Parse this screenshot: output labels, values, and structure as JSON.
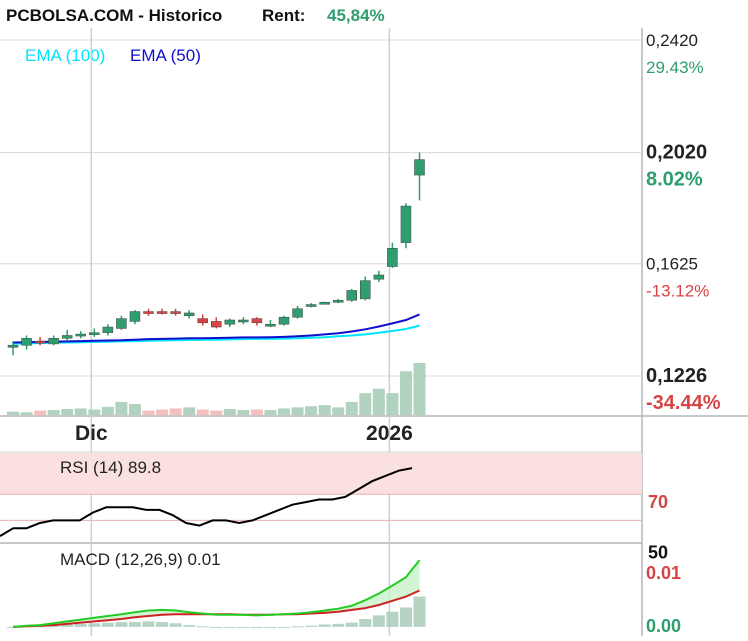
{
  "header": {
    "site": "PCBOLSA.COM - Historico",
    "rent_label": "Rent:",
    "rent_value": "45,84%"
  },
  "colors": {
    "up": "#2e9e6e",
    "down": "#d64545",
    "ema100": "#00e5ff",
    "ema50": "#1010cc",
    "rsi_line": "#000000",
    "rsi_band": "#fbe0e0",
    "macd_line": "#22cc22",
    "signal_line": "#cc2222",
    "hist_fill": "#c9f2c9",
    "volume_up": "#a9cdb8",
    "volume_down": "#f2b8b8",
    "grid": "#d8d8d8"
  },
  "chart_data": {
    "type": "candlestick",
    "legend": {
      "ema100": "EMA (100)",
      "ema50": "EMA (50)"
    },
    "price_axis": {
      "ylim": [
        0.1226,
        0.242
      ],
      "ticks": [
        {
          "price": 0.242,
          "label": "0,2420",
          "pct": "29.43%",
          "pct_color": "up",
          "bold": false
        },
        {
          "price": 0.202,
          "label": "0,2020",
          "pct": "8.02%",
          "pct_color": "up",
          "bold": true
        },
        {
          "price": 0.1625,
          "label": "0,1625",
          "pct": "-13.12%",
          "pct_color": "down",
          "bold": false
        },
        {
          "price": 0.1226,
          "label": "0,1226",
          "pct": "-34.44%",
          "pct_color": "down",
          "bold": true
        }
      ]
    },
    "x_axis": {
      "labels": [
        {
          "index": 6,
          "label": "Dic"
        },
        {
          "index": 28,
          "label": "2026"
        }
      ]
    },
    "candles": [
      {
        "o": 0.133,
        "h": 0.135,
        "l": 0.13,
        "c": 0.1335
      },
      {
        "o": 0.1335,
        "h": 0.137,
        "l": 0.132,
        "c": 0.136
      },
      {
        "o": 0.135,
        "h": 0.1365,
        "l": 0.1335,
        "c": 0.1345
      },
      {
        "o": 0.134,
        "h": 0.137,
        "l": 0.1335,
        "c": 0.136
      },
      {
        "o": 0.136,
        "h": 0.139,
        "l": 0.135,
        "c": 0.137
      },
      {
        "o": 0.137,
        "h": 0.1385,
        "l": 0.136,
        "c": 0.1375
      },
      {
        "o": 0.1375,
        "h": 0.1395,
        "l": 0.1365,
        "c": 0.138
      },
      {
        "o": 0.138,
        "h": 0.141,
        "l": 0.137,
        "c": 0.14
      },
      {
        "o": 0.1395,
        "h": 0.144,
        "l": 0.139,
        "c": 0.143
      },
      {
        "o": 0.142,
        "h": 0.146,
        "l": 0.141,
        "c": 0.1455
      },
      {
        "o": 0.1455,
        "h": 0.1465,
        "l": 0.144,
        "c": 0.145
      },
      {
        "o": 0.1455,
        "h": 0.1465,
        "l": 0.1445,
        "c": 0.145
      },
      {
        "o": 0.1455,
        "h": 0.1465,
        "l": 0.144,
        "c": 0.145
      },
      {
        "o": 0.144,
        "h": 0.146,
        "l": 0.143,
        "c": 0.145
      },
      {
        "o": 0.143,
        "h": 0.1445,
        "l": 0.1405,
        "c": 0.1415
      },
      {
        "o": 0.142,
        "h": 0.1435,
        "l": 0.1395,
        "c": 0.14
      },
      {
        "o": 0.141,
        "h": 0.143,
        "l": 0.14,
        "c": 0.1425
      },
      {
        "o": 0.142,
        "h": 0.1435,
        "l": 0.141,
        "c": 0.1425
      },
      {
        "o": 0.143,
        "h": 0.1435,
        "l": 0.1405,
        "c": 0.1415
      },
      {
        "o": 0.141,
        "h": 0.1425,
        "l": 0.14,
        "c": 0.141
      },
      {
        "o": 0.141,
        "h": 0.144,
        "l": 0.1405,
        "c": 0.1435
      },
      {
        "o": 0.1435,
        "h": 0.1475,
        "l": 0.143,
        "c": 0.1465
      },
      {
        "o": 0.1475,
        "h": 0.1485,
        "l": 0.147,
        "c": 0.148
      },
      {
        "o": 0.1485,
        "h": 0.149,
        "l": 0.148,
        "c": 0.1488
      },
      {
        "o": 0.149,
        "h": 0.15,
        "l": 0.1485,
        "c": 0.1495
      },
      {
        "o": 0.1495,
        "h": 0.1535,
        "l": 0.149,
        "c": 0.153
      },
      {
        "o": 0.15,
        "h": 0.158,
        "l": 0.1495,
        "c": 0.1565
      },
      {
        "o": 0.157,
        "h": 0.16,
        "l": 0.156,
        "c": 0.1585
      },
      {
        "o": 0.1615,
        "h": 0.17,
        "l": 0.161,
        "c": 0.168
      },
      {
        "o": 0.17,
        "h": 0.184,
        "l": 0.168,
        "c": 0.183
      },
      {
        "o": 0.194,
        "h": 0.202,
        "l": 0.185,
        "c": 0.1995
      }
    ],
    "ema100": [
      0.134,
      0.1342,
      0.1343,
      0.1344,
      0.1345,
      0.1346,
      0.1347,
      0.1348,
      0.1349,
      0.135,
      0.1351,
      0.1352,
      0.1353,
      0.1354,
      0.1355,
      0.1355,
      0.1356,
      0.1357,
      0.1358,
      0.1358,
      0.1359,
      0.136,
      0.1362,
      0.1364,
      0.1367,
      0.137,
      0.1374,
      0.138,
      0.1386,
      0.1393,
      0.1405
    ],
    "ema50": [
      0.1345,
      0.1346,
      0.1347,
      0.1348,
      0.1349,
      0.135,
      0.1351,
      0.1352,
      0.1353,
      0.1355,
      0.1357,
      0.1358,
      0.1359,
      0.136,
      0.136,
      0.1361,
      0.1362,
      0.1363,
      0.1363,
      0.1364,
      0.1365,
      0.1367,
      0.137,
      0.1374,
      0.1378,
      0.1384,
      0.1392,
      0.1402,
      0.1413,
      0.1425,
      0.1445
    ],
    "volume": [
      6,
      5,
      8,
      9,
      11,
      12,
      10,
      15,
      24,
      20,
      8,
      10,
      12,
      14,
      10,
      8,
      11,
      9,
      10,
      9,
      12,
      14,
      16,
      18,
      14,
      24,
      40,
      48,
      40,
      80,
      95
    ],
    "rsi": {
      "label": "RSI (14) 89.8",
      "levels": [
        70,
        50
      ],
      "ylim": [
        35,
        100
      ],
      "values": [
        38,
        44,
        44,
        48,
        50,
        50,
        50,
        56,
        60,
        60,
        60,
        58,
        58,
        54,
        48,
        46,
        50,
        50,
        48,
        50,
        54,
        58,
        62,
        64,
        66,
        66,
        68,
        74,
        80,
        84,
        88,
        90
      ]
    },
    "macd": {
      "label": "MACD (12,26,9) 0.01",
      "ticks": [
        {
          "value": 0.01,
          "label": "0.01",
          "color": "down"
        },
        {
          "value": 0.0,
          "label": "0.00",
          "color": "up"
        }
      ],
      "ylim": [
        -0.0015,
        0.013
      ],
      "macd_line": [
        0.0,
        0.0002,
        0.0003,
        0.0006,
        0.0009,
        0.0012,
        0.0015,
        0.0018,
        0.0021,
        0.0024,
        0.0027,
        0.0028,
        0.0027,
        0.0024,
        0.0022,
        0.002,
        0.002,
        0.002,
        0.0019,
        0.002,
        0.0021,
        0.0022,
        0.0024,
        0.0027,
        0.003,
        0.0035,
        0.0044,
        0.0055,
        0.0068,
        0.0082,
        0.011
      ],
      "signal_line": [
        0.0,
        0.0001,
        0.0002,
        0.0003,
        0.0005,
        0.0007,
        0.0009,
        0.0011,
        0.0013,
        0.0016,
        0.0018,
        0.002,
        0.0021,
        0.0021,
        0.0021,
        0.0021,
        0.0021,
        0.002,
        0.002,
        0.002,
        0.0021,
        0.0021,
        0.0022,
        0.0023,
        0.0025,
        0.0028,
        0.0031,
        0.0036,
        0.0043,
        0.005,
        0.006
      ],
      "histogram": [
        0.0,
        0.0001,
        0.0001,
        0.0003,
        0.0004,
        0.0005,
        0.0006,
        0.0007,
        0.0008,
        0.0008,
        0.0009,
        0.0008,
        0.0006,
        0.0003,
        0.0001,
        -0.0001,
        -0.0001,
        0.0,
        -0.0001,
        0.0,
        0.0,
        0.0001,
        0.0002,
        0.0004,
        0.0005,
        0.0007,
        0.0013,
        0.0019,
        0.0025,
        0.0032,
        0.005
      ]
    }
  }
}
